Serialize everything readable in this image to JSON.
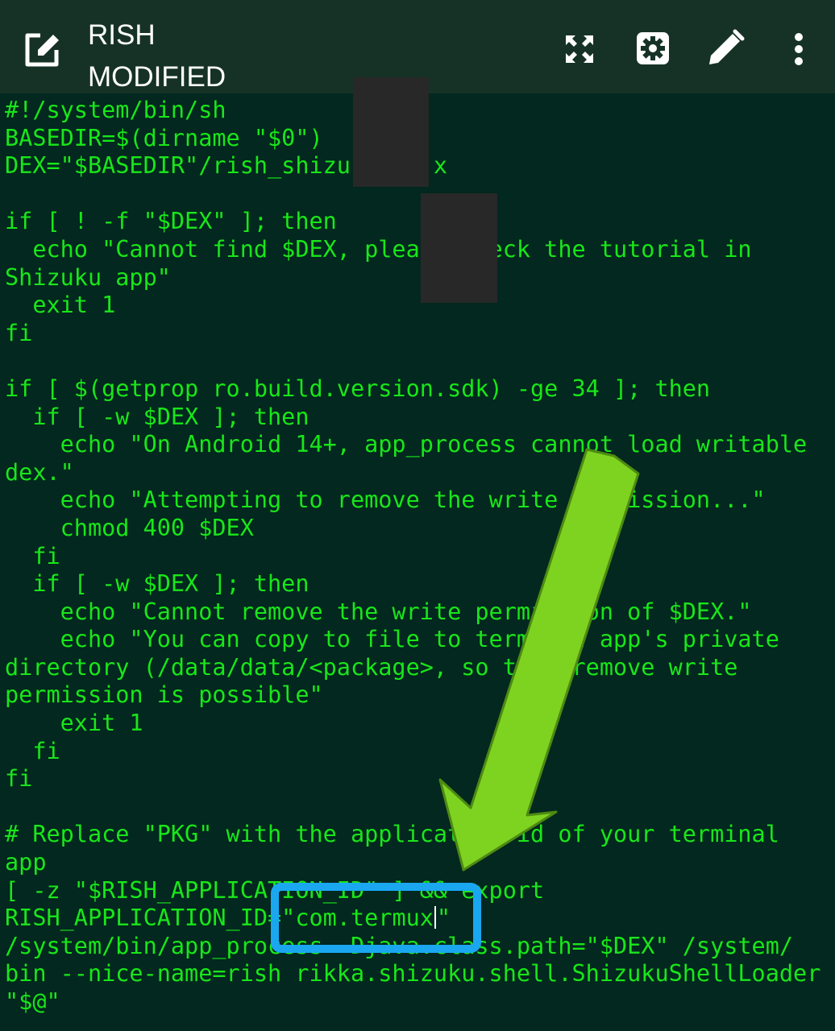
{
  "toolbar": {
    "title": "RISH",
    "subtitle": "MODIFIED",
    "icons": [
      "edit-square-icon",
      "fullscreen-icon",
      "settings-icon",
      "pencil-icon",
      "more-vert-icon"
    ]
  },
  "editor": {
    "lines": [
      "#!/system/bin/sh",
      "BASEDIR=$(dirname \"$0\")",
      "DEX=\"$BASEDIR\"/rish_shizu      x",
      "",
      "if [ ! -f \"$DEX\" ]; then",
      "  echo \"Cannot find $DEX, plea     eck the tutorial in",
      "Shizuku app\"",
      "  exit 1",
      "fi",
      "",
      "if [ $(getprop ro.build.version.sdk) -ge 34 ]; then",
      "  if [ -w $DEX ]; then",
      "    echo \"On Android 14+, app_process cannot load writable",
      "dex.\"",
      "    echo \"Attempting to remove the write permission...\"",
      "    chmod 400 $DEX",
      "  fi",
      "  if [ -w $DEX ]; then",
      "    echo \"Cannot remove the write permission of $DEX.\"",
      "    echo \"You can copy to file to terminal app's private",
      "directory (/data/data/<package>, so that remove write",
      "permission is possible\"",
      "    exit 1",
      "  fi",
      "fi",
      "",
      "# Replace \"PKG\" with the application id of your terminal",
      "app",
      "[ -z \"$RISH_APPLICATION_ID\" ] && export",
      "/system/bin/app_process -Djava.class.path=\"$DEX\" /system/",
      "bin --nice-name=rish rikka.shizuku.shell.ShizukuShellLoader",
      "\"$@\""
    ],
    "rish_line_prefix": "RISH_APPLICATION_ID=",
    "rish_line_value": "\"com.termux",
    "rish_line_suffix": "\""
  },
  "colors": {
    "toolbar_bg": "#163227",
    "editor_bg": "#02281f",
    "code_text": "#19e619",
    "arrow": "#7ed321",
    "highlight_box": "#1aa7f0",
    "redaction": "#282828"
  }
}
